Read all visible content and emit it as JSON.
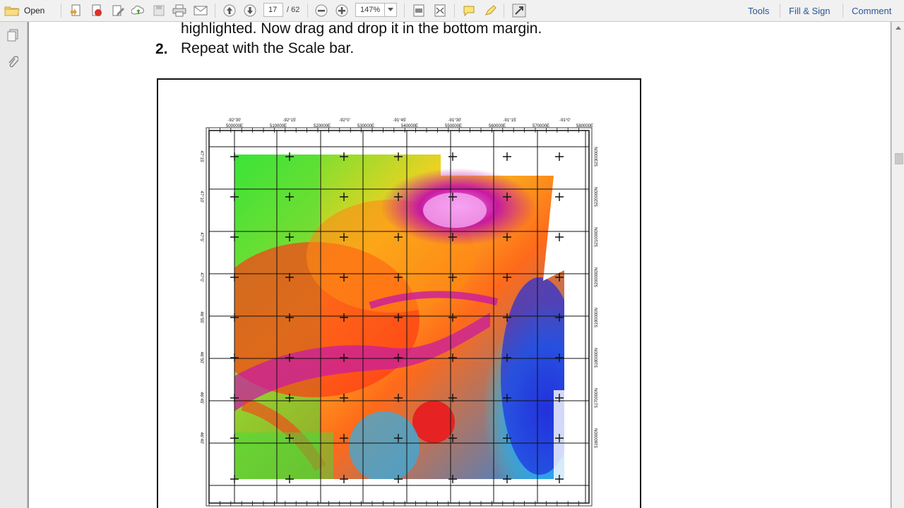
{
  "toolbar": {
    "open_label": "Open",
    "page_current": "17",
    "page_total": "/ 62",
    "zoom": "147%",
    "tools_label": "Tools",
    "fill_sign_label": "Fill & Sign",
    "comment_label": "Comment"
  },
  "document": {
    "line_partial": "highlighted. Now drag and drop it in the bottom margin.",
    "step_number": "2.",
    "step_text": "Repeat with the Scale bar."
  },
  "map": {
    "top_labels": [
      "-92°30'",
      "-92°15'",
      "-92°0'",
      "-91°45'",
      "-91°30'",
      "-91°15'",
      "-91°0'"
    ],
    "top_labels_2": [
      "500000E",
      "510000E",
      "520000E",
      "530000E",
      "540000E",
      "550000E",
      "560000E",
      "570000E",
      "580000E"
    ],
    "left_labels": [
      "47°15'",
      "47°10'",
      "47°5'",
      "47°0'",
      "46°55'",
      "46°50'",
      "46°45'",
      "46°40'"
    ],
    "right_labels": [
      "5230000N",
      "5220000N",
      "5210000N",
      "5200000N",
      "5190000N",
      "5180000N",
      "5170000N",
      "5160000N"
    ]
  },
  "colors": {
    "link": "#2a5699",
    "toolbar_bg": "#f1f1f1",
    "canvas_bg": "#9a9a9a"
  },
  "icons": [
    "folder-icon",
    "create-pdf-icon",
    "convert-icon",
    "edit-icon",
    "upload-icon",
    "save-icon",
    "print-icon",
    "email-icon",
    "prev-page-icon",
    "next-page-icon",
    "zoom-out-icon",
    "zoom-in-icon",
    "fit-page-icon",
    "fit-width-icon",
    "comment-icon",
    "highlight-icon",
    "fullscreen-icon",
    "pages-icon",
    "attachment-icon"
  ]
}
